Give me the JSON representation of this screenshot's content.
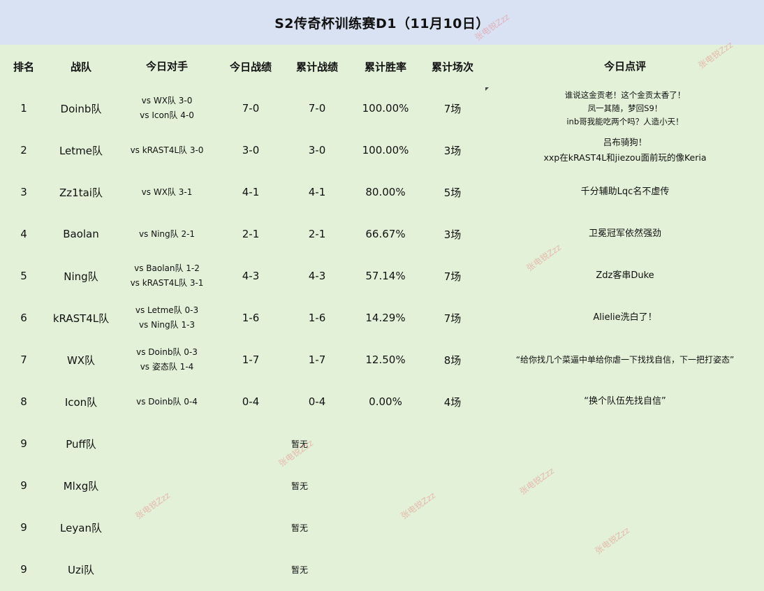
{
  "title": "S2传奇杯训练赛D1（11月10日）",
  "headers": {
    "rank": "排名",
    "team": "战队",
    "opponents": "今日对手",
    "today": "今日战绩",
    "total": "累计战绩",
    "rate": "累计胜率",
    "games": "累计场次",
    "comment": "今日点评"
  },
  "rows": [
    {
      "rank": "1",
      "team": "Doinb队",
      "opp1": "vs WX队 3-0",
      "opp2": "vs Icon队 4-0",
      "today": "7-0",
      "total": "7-0",
      "rate": "100.00%",
      "games": "7场",
      "c1": "谁说这金贡老！这个金贡太香了！",
      "c2": "凤一其随，梦回S9！",
      "c3": "inb哥我能吃两个吗？人造小天！"
    },
    {
      "rank": "2",
      "team": "Letme队",
      "opp1": "vs kRAST4L队 3-0",
      "opp2": "",
      "today": "3-0",
      "total": "3-0",
      "rate": "100.00%",
      "games": "3场",
      "c1": "吕布骑狗！",
      "c2": "xxp在kRAST4L和jiezou面前玩的像Keria",
      "c3": ""
    },
    {
      "rank": "3",
      "team": "Zz1tai队",
      "opp1": "vs WX队 3-1",
      "opp2": "",
      "today": "4-1",
      "total": "4-1",
      "rate": "80.00%",
      "games": "5场",
      "c1": "千分辅助Lqc名不虚传",
      "c2": "",
      "c3": ""
    },
    {
      "rank": "4",
      "team": "Baolan",
      "opp1": "vs Ning队 2-1",
      "opp2": "",
      "today": "2-1",
      "total": "2-1",
      "rate": "66.67%",
      "games": "3场",
      "c1": "卫冕冠军依然强劲",
      "c2": "",
      "c3": ""
    },
    {
      "rank": "5",
      "team": "Ning队",
      "opp1": "vs Baolan队 1-2",
      "opp2": "vs kRAST4L队 3-1",
      "today": "4-3",
      "total": "4-3",
      "rate": "57.14%",
      "games": "7场",
      "c1": "Zdz客串Duke",
      "c2": "",
      "c3": ""
    },
    {
      "rank": "6",
      "team": "kRAST4L队",
      "opp1": "vs Letme队 0-3",
      "opp2": "vs Ning队 1-3",
      "today": "1-6",
      "total": "1-6",
      "rate": "14.29%",
      "games": "7场",
      "c1": "Alielie洗白了！",
      "c2": "",
      "c3": ""
    },
    {
      "rank": "7",
      "team": "WX队",
      "opp1": "vs Doinb队 0-3",
      "opp2": "vs 姿态队 1-4",
      "today": "1-7",
      "total": "1-7",
      "rate": "12.50%",
      "games": "8场",
      "c1": "“给你找几个菜逼中单给你虐一下找找自信，下一把打姿态”",
      "c2": "",
      "c3": ""
    },
    {
      "rank": "8",
      "team": "Icon队",
      "opp1": "vs Doinb队 0-4",
      "opp2": "",
      "today": "0-4",
      "total": "0-4",
      "rate": "0.00%",
      "games": "4场",
      "c1": "“换个队伍先找自信”",
      "c2": "",
      "c3": ""
    },
    {
      "rank": "9",
      "team": "Puff队",
      "none": "暂无"
    },
    {
      "rank": "9",
      "team": "Mlxg队",
      "none": "暂无"
    },
    {
      "rank": "9",
      "team": "Leyan队",
      "none": "暂无"
    },
    {
      "rank": "9",
      "team": "Uzi队",
      "none": "暂无"
    }
  ],
  "watermark": "张电锐Zzz",
  "colors": {
    "title_bg": "#d9e2f3",
    "table_bg": "#e2f1d8",
    "watermark": "#eb6e6e"
  }
}
